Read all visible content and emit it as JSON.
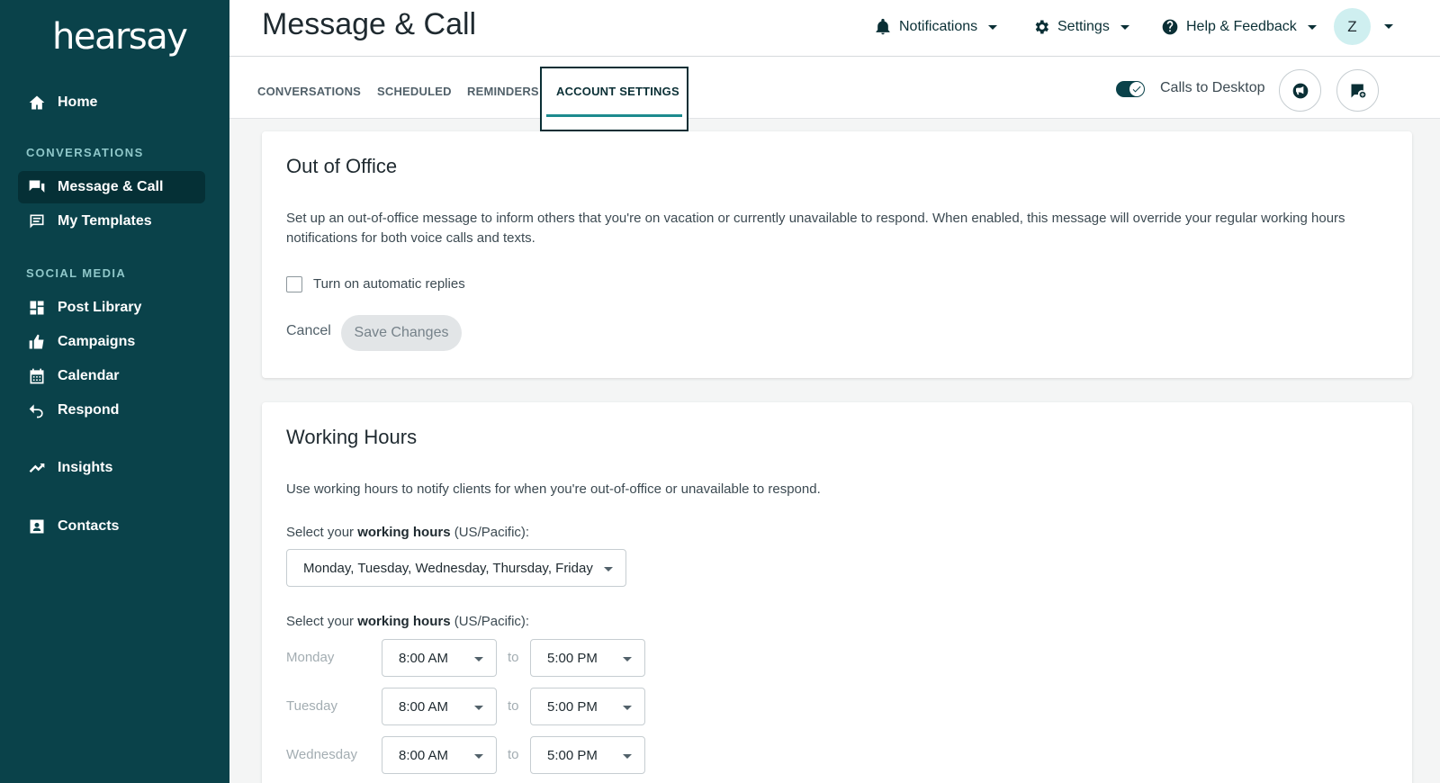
{
  "brand": {
    "logo_text": "hearsay"
  },
  "sidebar": {
    "home": "Home",
    "section_conversations": "CONVERSATIONS",
    "message_call": "Message & Call",
    "my_templates": "My Templates",
    "section_social": "SOCIAL MEDIA",
    "post_library": "Post Library",
    "campaigns": "Campaigns",
    "calendar": "Calendar",
    "respond": "Respond",
    "insights": "Insights",
    "contacts": "Contacts"
  },
  "header": {
    "title": "Message & Call",
    "notifications": "Notifications",
    "settings": "Settings",
    "help": "Help & Feedback",
    "avatar_initial": "Z"
  },
  "tabs": {
    "conversations": "CONVERSATIONS",
    "scheduled": "SCHEDULED",
    "reminders": "REMINDERS",
    "account_settings": "ACCOUNT SETTINGS",
    "calls_to_desktop": "Calls to Desktop"
  },
  "out_of_office": {
    "title": "Out of Office",
    "description": "Set up an out-of-office message to inform others that you're on vacation or currently unavailable to respond. When enabled, this message will override your regular working hours notifications for both voice calls and texts.",
    "checkbox_label": "Turn on automatic replies",
    "cancel": "Cancel",
    "save": "Save Changes"
  },
  "working_hours": {
    "title": "Working Hours",
    "description": "Use working hours to notify clients for when you're out-of-office or unavailable to respond.",
    "select_prefix": "Select your ",
    "select_bold": "working hours",
    "select_suffix": " (US/Pacific):",
    "days_value": "Monday, Tuesday, Wednesday, Thursday, Friday",
    "to": "to",
    "rows": [
      {
        "day": "Monday",
        "start": "8:00 AM",
        "end": "5:00 PM"
      },
      {
        "day": "Tuesday",
        "start": "8:00 AM",
        "end": "5:00 PM"
      },
      {
        "day": "Wednesday",
        "start": "8:00 AM",
        "end": "5:00 PM"
      }
    ]
  },
  "colors": {
    "sidebar_bg": "#0a424a",
    "accent": "#1c8a8e",
    "active_nav": "#053036"
  }
}
